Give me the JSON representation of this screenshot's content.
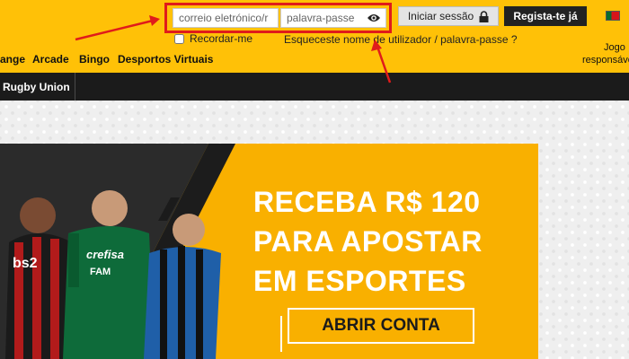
{
  "login": {
    "email_placeholder": "correio eletrónico/r",
    "password_placeholder": "palavra-passe",
    "login_label": "Iniciar sessão",
    "register_label": "Regista-te já",
    "remember_label": "Recordar-me",
    "forgot_prefix": "Esqueceste ",
    "forgot_username": "nome de utilizador",
    "forgot_sep": " / ",
    "forgot_password": "palavra-passe",
    "forgot_suffix": " ?"
  },
  "nav": {
    "items": [
      "ange",
      "Arcade",
      "Bingo",
      "Desportos Virtuais"
    ],
    "responsible": [
      "Jogo",
      "responsável"
    ]
  },
  "subnav": {
    "item": "Rugby Union"
  },
  "banner": {
    "headline": [
      "RECEBA R$ 120",
      "PARA APOSTAR",
      "EM ESPORTES"
    ],
    "cta": "ABRIR CONTA",
    "sponsor_1": "bs2",
    "sponsor_2": "crefisa",
    "sponsor_3": "FAM"
  },
  "colors": {
    "header_bg": "#ffc107",
    "subnav_bg": "#1b1b1b",
    "banner_bg": "#f9b000",
    "highlight": "#e01b1b",
    "register_bg": "#222222"
  },
  "icons": [
    "eye-icon",
    "lock-icon",
    "flag-icon",
    "checkbox-icon"
  ]
}
